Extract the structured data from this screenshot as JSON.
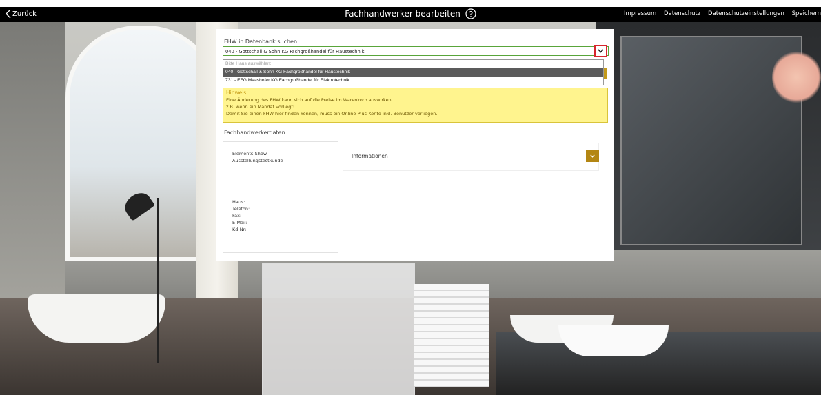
{
  "header": {
    "back_label": "Zurück",
    "title": "Fachhandwerker bearbeiten",
    "nav": [
      "Impressum",
      "Datenschutz",
      "Datenschutzeinstellungen",
      "Speichern"
    ]
  },
  "dialog": {
    "search_label": "FHW in Datenbank suchen:",
    "selected_value": "040 - Gottschall & Sohn KG Fachgroßhandel für Haustechnik",
    "dropdown": {
      "placeholder": "Bitte Haus auswählen:",
      "options": [
        {
          "label": "040 - Gottschall & Sohn KG Fachgroßhandel für Haustechnik",
          "selected": true
        },
        {
          "label": "731 - EFG Maashofer KG Fachgroßhandel für Elektrotechnik",
          "selected": false
        }
      ]
    },
    "hint": {
      "title": "Hinweis",
      "lines": [
        "Eine Änderung des FHW kann sich auf die Preise im Warenkorb auswirken",
        "z.B. wenn ein Mandat vorliegt!",
        "Damit Sie einen FHW hier finden können, muss ein Online-Plus-Konto inkl. Benutzer vorliegen."
      ]
    },
    "section_label": "Fachhandwerkerdaten:",
    "card": {
      "name_line1": "Elements-Show",
      "name_line2": "Ausstellungstestkunde",
      "fields": [
        "Haus:",
        "Telefon:",
        "Fax:",
        "E-Mail:",
        "Kd-Nr:"
      ]
    },
    "info_panel": {
      "label": "Informationen"
    },
    "colors": {
      "accent_gold": "#b38613",
      "hint_bg": "#fff48e",
      "border_green": "#59a53a",
      "highlight_red": "#d7262d"
    }
  }
}
